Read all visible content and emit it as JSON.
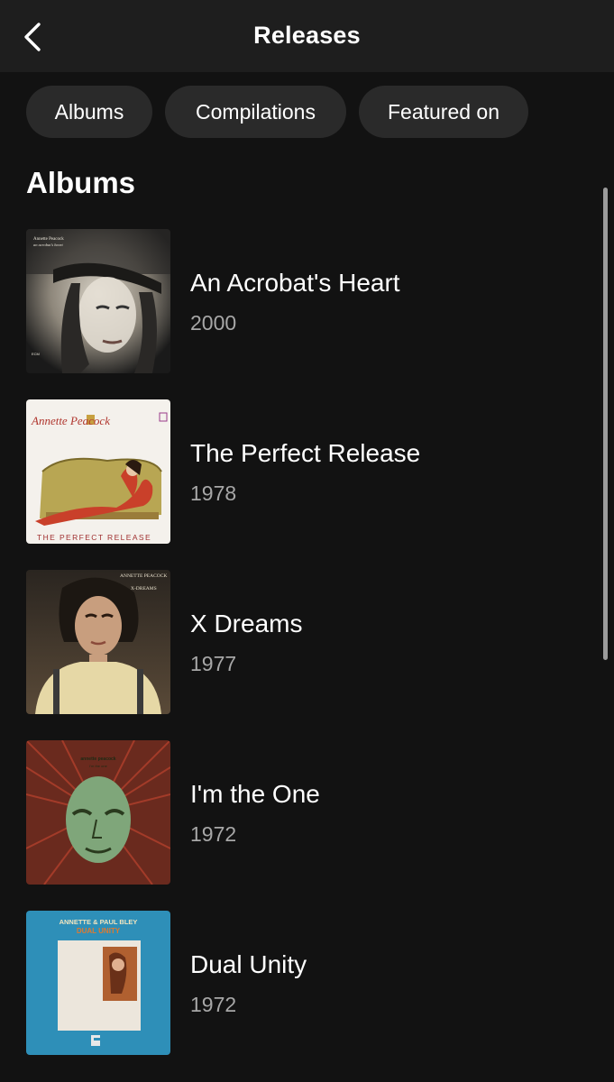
{
  "header": {
    "title": "Releases"
  },
  "filters": [
    {
      "label": "Albums"
    },
    {
      "label": "Compilations"
    },
    {
      "label": "Featured on"
    }
  ],
  "section": {
    "title": "Albums"
  },
  "albums": [
    {
      "title": "An Acrobat's Heart",
      "year": "2000",
      "cover_text": [
        "Annette Peacock",
        "an acrobat's heart",
        "ECM"
      ]
    },
    {
      "title": "The Perfect Release",
      "year": "1978",
      "cover_text": [
        "Annette Peacock",
        "THE PERFECT RELEASE"
      ]
    },
    {
      "title": "X Dreams",
      "year": "1977",
      "cover_text": [
        "ANNETTE PEACOCK",
        "X-DREAMS"
      ]
    },
    {
      "title": "I'm the One",
      "year": "1972",
      "cover_text": [
        "annette peacock",
        "I'm the one"
      ]
    },
    {
      "title": "Dual Unity",
      "year": "1972",
      "cover_text": [
        "ANNETTE & PAUL BLEY",
        "DUAL UNITY"
      ]
    }
  ],
  "colors": {
    "background": "#121212",
    "header": "#1e1e1e",
    "chip": "#2a2a2a",
    "secondary_text": "#a7a7a7"
  },
  "icons": {
    "back": "chevron-left-icon"
  }
}
